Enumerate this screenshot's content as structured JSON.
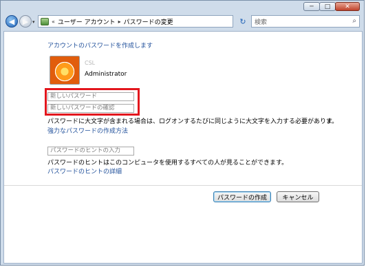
{
  "window": {
    "controls": {
      "minimize": "─",
      "maximize": "□",
      "close": "✕"
    }
  },
  "navbar": {
    "back_glyph": "◀",
    "forward_glyph": "▶",
    "dropdown_glyph": "▾",
    "breadcrumb_prefix": "«",
    "breadcrumb": [
      "ユーザー アカウント",
      "パスワードの変更"
    ],
    "breadcrumb_sep": "▸",
    "refresh_glyph": "↻",
    "search_placeholder": "検索",
    "search_icon_glyph": "⌕"
  },
  "content": {
    "heading": "アカウントのパスワードを作成します",
    "user": {
      "name": "CSL",
      "type": "Administrator"
    },
    "fields": {
      "new_password_placeholder": "新しいパスワード",
      "confirm_password_placeholder": "新しいパスワードの確認",
      "hint_placeholder": "パスワードのヒントの入力"
    },
    "warning_text": "パスワードに大文字が含まれる場合は、ログオンするたびに同じように大文字を入力する必要がありま",
    "warning_text_cont": "す。",
    "strong_password_link": "強力なパスワードの作成方法",
    "hint_notice": "パスワードのヒントはこのコンピュータを使用するすべての人が見ることができます。",
    "hint_details_link": "パスワードのヒントの詳細"
  },
  "buttons": {
    "create": "パスワードの作成",
    "cancel": "キャンセル"
  },
  "colors": {
    "link": "#1f4f9a",
    "highlight": "#e3161d"
  }
}
